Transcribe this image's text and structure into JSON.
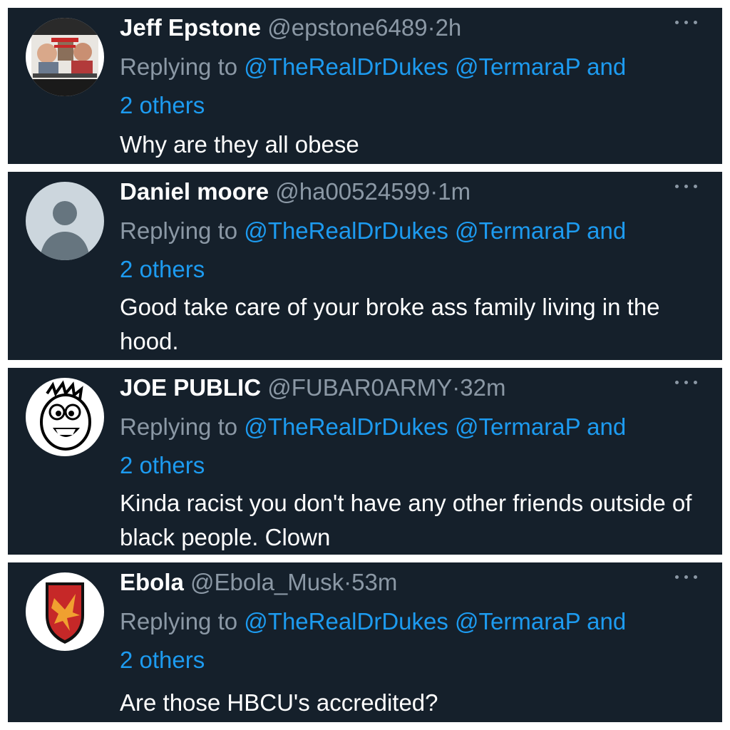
{
  "reply_prefix": "Replying to",
  "replies": [
    {
      "name": "Jeff Epstone",
      "handle": "@epstone6489",
      "separator": "·",
      "time": "2h",
      "mention_1": "@TheRealDrDukes",
      "mention_2": "@TermaraP",
      "connector": "and",
      "others": "2 others",
      "text": "Why are they all obese",
      "avatar_icon": "photo-collage-avatar"
    },
    {
      "name": "Daniel moore",
      "handle": "@ha00524599",
      "separator": "·",
      "time": "1m",
      "mention_1": "@TheRealDrDukes",
      "mention_2": "@TermaraP",
      "connector": "and",
      "others": "2 others",
      "text": "Good take care of your broke ass family living in the hood.",
      "avatar_icon": "default-profile-avatar"
    },
    {
      "name": "JOE PUBLIC",
      "handle": "@FUBAR0ARMY",
      "separator": "·",
      "time": "32m",
      "mention_1": "@TheRealDrDukes",
      "mention_2": "@TermaraP",
      "connector": "and",
      "others": "2 others",
      "text": "Kinda racist you don't have any other friends outside of black people. Clown",
      "avatar_icon": "cartoon-face-avatar"
    },
    {
      "name": "Ebola",
      "handle": "@Ebola_Musk",
      "separator": "·",
      "time": "53m",
      "mention_1": "@TheRealDrDukes",
      "mention_2": "@TermaraP",
      "connector": "and",
      "others": "2 others",
      "text": "Are those HBCU's accredited?",
      "avatar_icon": "eagle-shield-avatar"
    }
  ],
  "colors": {
    "panel_bg": "#15202b",
    "name": "#ffffff",
    "secondary": "#8b98a5",
    "link": "#1d9bf0"
  }
}
